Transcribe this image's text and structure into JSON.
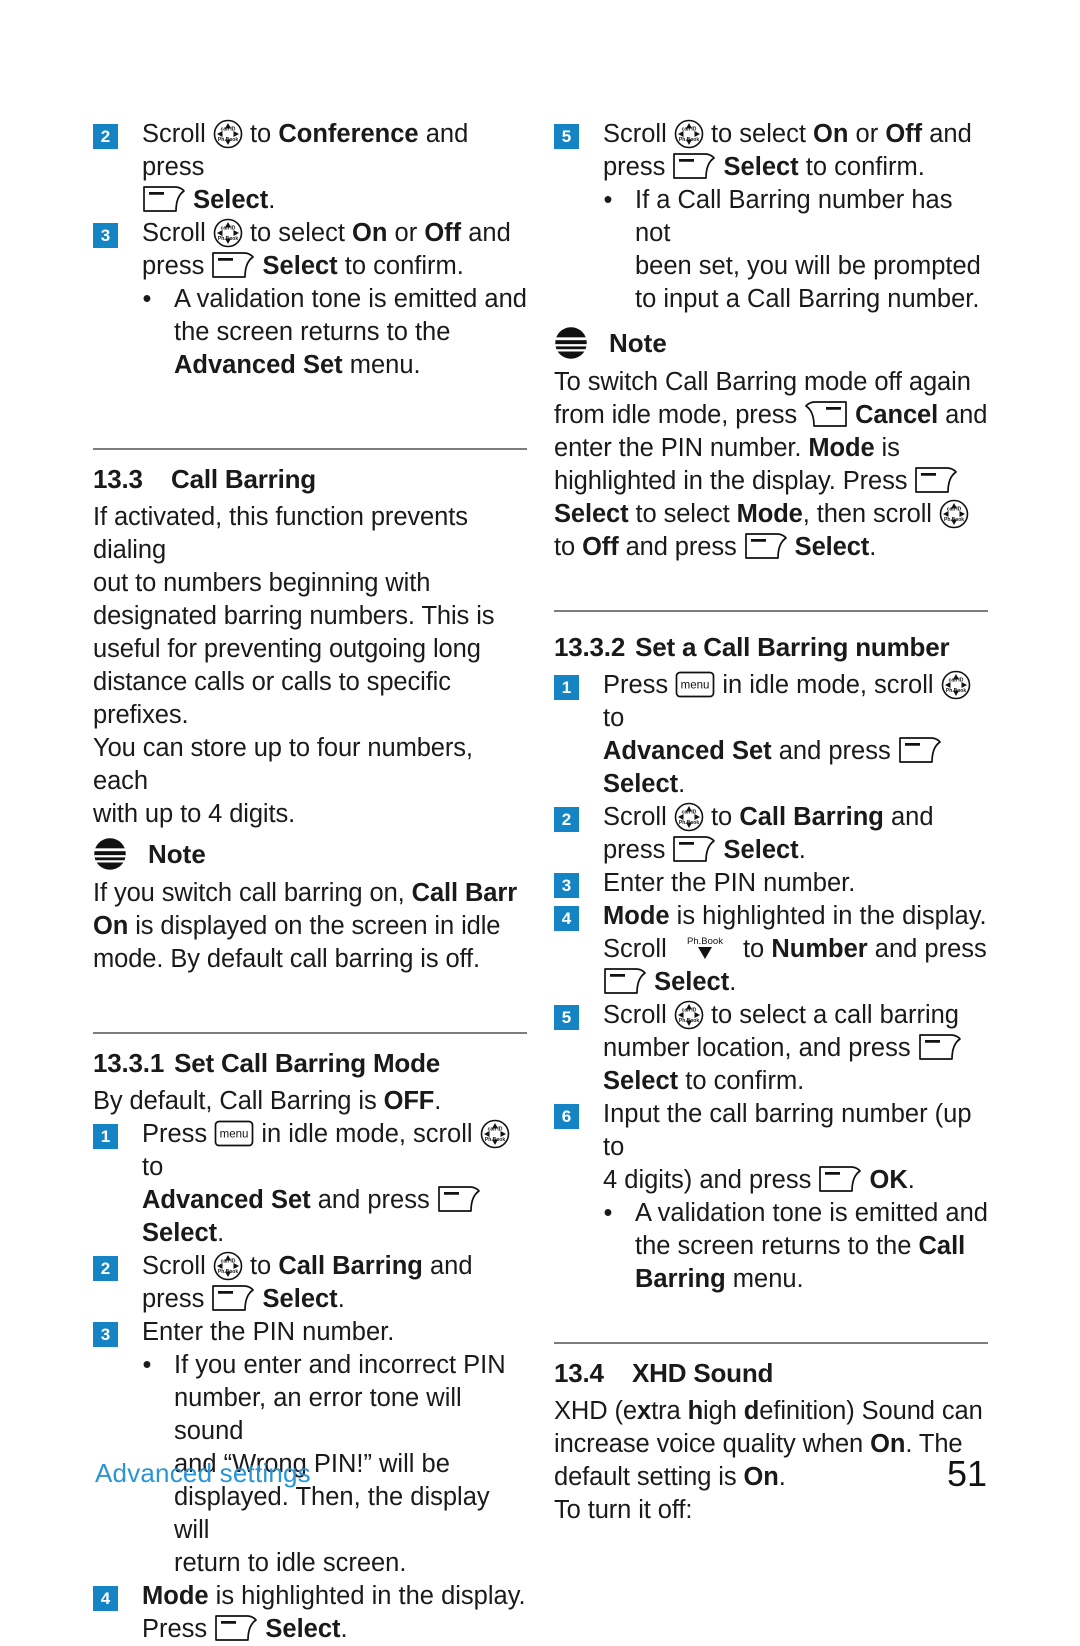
{
  "document": {
    "footer_section": "Advanced settings",
    "page_number": "51"
  },
  "icons": {
    "scroll": "scroll-nav-key-icon",
    "select_softkey": "left-softkey-icon",
    "cancel_softkey": "right-softkey-icon",
    "menu_key": "menu-key-icon",
    "phonebook_down": "phonebook-down-key-icon",
    "note": "note-bullet-icon"
  },
  "colors": {
    "badge": "#1484C4",
    "footer_link": "#2a95d6",
    "rule": "#7d7d7d"
  },
  "left_column": {
    "steps_top": [
      {
        "number": "2",
        "parts": [
          {
            "t": "Scroll ",
            "b": false
          },
          {
            "t": "icon:scroll",
            "b": false
          },
          {
            "t": " to ",
            "b": false
          },
          {
            "t": "Conference",
            "b": true
          },
          {
            "t": " and press ",
            "b": false
          },
          {
            "t": "icon:select",
            "b": false
          },
          {
            "t": " ",
            "b": false
          },
          {
            "t": "Select",
            "b": true
          },
          {
            "t": ".",
            "b": false
          }
        ],
        "text": "Scroll [scroll] to Conference and press [select] Select."
      },
      {
        "number": "3",
        "text": "Scroll [scroll] to select On or Off and press [select] Select to confirm."
      }
    ],
    "bullet_top": "A validation tone is emitted and the screen returns to the Advanced Set menu.",
    "section_13_3": {
      "number": "13.3",
      "title": "Call Barring",
      "body": "If activated, this function prevents dialing out to numbers beginning with designated barring numbers. This is useful for preventing outgoing long distance calls or calls to specific prefixes. You can store up to four numbers, each with up to 4 digits."
    },
    "note": {
      "title": "Note",
      "body": "If you switch call barring on, Call Barr On is displayed on the screen in idle mode. By default call barring is off."
    },
    "section_13_3_1": {
      "number": "13.3.1",
      "title": "Set Call Barring Mode",
      "intro": "By default, Call Barring is OFF.",
      "steps": [
        {
          "number": "1",
          "text": "Press [menu] in idle mode, scroll [scroll] to Advanced Set and press [select] Select."
        },
        {
          "number": "2",
          "text": "Scroll [scroll] to Call Barring and press [select] Select."
        },
        {
          "number": "3",
          "text": "Enter the PIN number."
        },
        {
          "number": "4",
          "text": "Mode is highlighted in the display. Press [select] Select."
        }
      ],
      "bullet_step3": "If you enter and incorrect PIN number, an error tone will sound and “Wrong PIN!” will be displayed. Then, the display will return to idle screen."
    }
  },
  "right_column": {
    "step_5": {
      "number": "5",
      "text": "Scroll [scroll] to select On or Off and press [select] Select to confirm."
    },
    "bullet_5": "If a Call Barring number has not been set, you will be prompted to input a Call Barring number.",
    "note": {
      "title": "Note",
      "body": "To switch Call Barring mode off again from idle mode, press [cancel] Cancel and enter the PIN number. Mode is highlighted in the display. Press [select] Select to select Mode, then scroll [scroll] to Off and press [select] Select."
    },
    "section_13_3_2": {
      "number": "13.3.2",
      "title": "Set a Call Barring number",
      "steps": [
        {
          "number": "1",
          "text": "Press [menu] in idle mode, scroll [scroll] to Advanced Set and press [select] Select."
        },
        {
          "number": "2",
          "text": "Scroll [scroll] to Call Barring and press [select] Select."
        },
        {
          "number": "3",
          "text": "Enter the PIN number."
        },
        {
          "number": "4",
          "text": "Mode is highlighted in the display. Scroll [phbook] to Number and press [select] Select."
        },
        {
          "number": "5",
          "text": "Scroll [scroll] to select a call barring number location, and press [select] Select to confirm."
        },
        {
          "number": "6",
          "text": "Input the call barring number (up to 4 digits) and press [select] OK."
        }
      ],
      "bullet_step6": "A validation tone is emitted and the screen returns to the Call Barring menu."
    },
    "section_13_4": {
      "number": "13.4",
      "title": "XHD Sound",
      "body": "XHD (extra high definition) Sound can increase voice quality when On. The default setting is On.",
      "body2": "To turn it off:"
    }
  },
  "text_fragments": {
    "scroll": "Scroll",
    "press": "press",
    "Press": "Press",
    "to": "to",
    "and": "and",
    "or": "or",
    "conference": "Conference",
    "select": "Select",
    "on": "On",
    "off": "Off",
    "to_confirm": "to confirm.",
    "validation_1": "A validation tone is emitted and",
    "validation_2": "the screen returns to the",
    "advanced_set": "Advanced Set",
    "menu_word": "menu.",
    "sec133_num": "13.3",
    "sec133_title": "Call Barring",
    "p133_l1": "If activated, this function prevents dialing",
    "p133_l2": "out to numbers beginning with",
    "p133_l3": "designated barring numbers. This is",
    "p133_l4": "useful for preventing outgoing long",
    "p133_l5": "distance calls or calls to specific prefixes.",
    "p133_l6": "You can store up to four numbers, each",
    "p133_l7": "with up to 4 digits.",
    "note": "Note",
    "note1_l1a": "If you switch call barring on, ",
    "note1_l1b": "Call Barr",
    "note1_l2a": "On",
    "note1_l2b": " is displayed on the screen in idle",
    "note1_l3": "mode. By default call barring is off.",
    "sec1331_num": "13.3.1",
    "sec1331_title": "Set Call Barring Mode",
    "by_default_a": "By default, Call Barring is ",
    "by_default_b": "OFF",
    "period": ".",
    "in_idle_mode": "in idle mode, scroll",
    "and_press": "and press",
    "call_barring": "Call Barring",
    "enter_pin": "Enter the PIN number.",
    "pin_b1": "If you enter and incorrect PIN",
    "pin_b2": "number, an error tone will sound",
    "pin_b3": "and “Wrong PIN!” will be",
    "pin_b4": "displayed. Then, the display will",
    "pin_b5": "return to idle screen.",
    "mode": "Mode",
    "mode_hl": " is highlighted in the display.",
    "to_select": "to select",
    "cb_b1": "If a Call Barring number has not",
    "cb_b2": "been set, you will be prompted",
    "cb_b3": "to input a Call Barring number.",
    "n2_l1": "To switch Call Barring mode off again",
    "n2_l2a": "from idle mode, press",
    "n2_l2b": "Cancel",
    "n2_l2c": " and",
    "n2_l3a": "enter the PIN number. ",
    "n2_l3b": "Mode",
    "n2_l3c": " is",
    "n2_l4a": "highlighted in the display. Press",
    "n2_l5a": "Select",
    "n2_l5b": " to select ",
    "n2_l5c": "Mode",
    "n2_l5d": ", then scroll",
    "n2_l6a": "to ",
    "n2_l6b": "Off",
    "n2_l6c": " and press",
    "sec1332_num": "13.3.2",
    "sec1332_title": "Set a Call Barring number",
    "number_word": "Number",
    "num_loc": "number location, and press",
    "select_confirm": "to confirm.",
    "input_cb1": "Input the call barring number (up to",
    "input_cb2": "4 digits) and press",
    "ok": "OK",
    "val2_l3a": "the screen returns to the ",
    "val2_l3b": "Call",
    "val2_l4a": "Barring",
    "val2_l4b": " menu.",
    "sec134_num": "13.4",
    "sec134_title": "XHD Sound",
    "xhd_l1a": "XHD (",
    "xhd_l1b": "e",
    "xhd_l1c": "x",
    "xhd_l1d": "tra ",
    "xhd_l1e": "h",
    "xhd_l1f": "igh ",
    "xhd_l1g": "d",
    "xhd_l1h": "efinition) Sound can",
    "xhd_l2a": "increase voice quality when ",
    "xhd_l2b": "On",
    "xhd_l2c": ". The",
    "xhd_l3a": "default setting is ",
    "xhd_l3b": "On",
    "xhd_l4": "To turn it off:",
    "call_barring_and": "and",
    "a_call_barring": "to select a call barring"
  }
}
